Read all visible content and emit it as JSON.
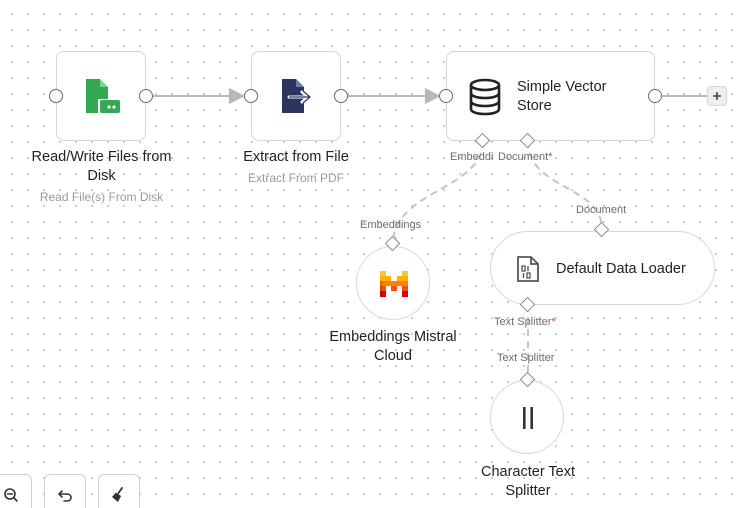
{
  "nodes": {
    "read_write": {
      "title": "Read/Write Files from Disk",
      "title_line1": "Read/Write Files from",
      "title_line2": "Disk",
      "subtitle": "Read File(s) From Disk",
      "icon": "file-disk-icon"
    },
    "extract": {
      "title": "Extract from File",
      "subtitle": "Extract From PDF",
      "icon": "file-export-icon"
    },
    "vector_store": {
      "title": "Simple Vector Store",
      "title_line1": "Simple Vector",
      "title_line2": "Store",
      "icon": "database-icon"
    },
    "embeddings": {
      "title": "Embeddings Mistral Cloud",
      "title_line1": "Embeddings Mistral",
      "title_line2": "Cloud",
      "icon": "mistral-logo-icon"
    },
    "data_loader": {
      "title": "Default Data Loader",
      "icon": "binary-file-icon"
    },
    "splitter": {
      "title": "Character Text Splitter",
      "title_line1": "Character Text",
      "title_line2": "Splitter",
      "icon": "pause-bars-icon"
    }
  },
  "ports": {
    "vector_embeddings": "Embeddi",
    "vector_document": "Document",
    "embeddings_in": "Embeddings",
    "loader_document": "Document",
    "loader_text_splitter": "Text Splitter",
    "splitter_out": "Text Splitter",
    "required_marker": "*"
  },
  "controls": {
    "add_icon": "plus-icon",
    "zoom_out_icon": "zoom-out-icon",
    "undo_icon": "undo-icon",
    "tidy_icon": "broom-icon"
  },
  "colors": {
    "disk_green": "#35a853",
    "extract_navy": "#2c3560",
    "connection": "#b7b7bd",
    "required": "#e2412f"
  }
}
